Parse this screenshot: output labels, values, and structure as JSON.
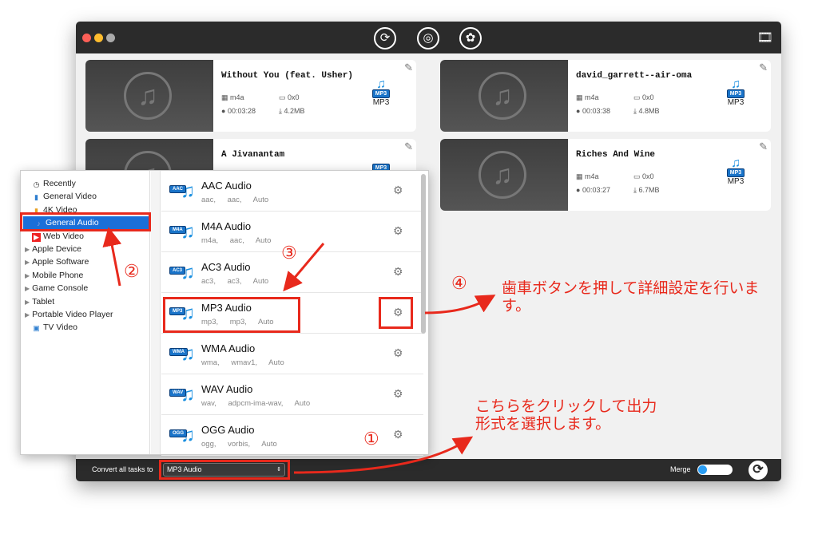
{
  "window": {
    "toolbar_icons": [
      "convert-icon",
      "burn-icon",
      "toolbox-icon"
    ],
    "media_icon": "media-browser-icon"
  },
  "tasks": [
    {
      "title": "Without You (feat. Usher)",
      "format": "m4a",
      "resolution": "0x0",
      "duration": "00:03:28",
      "size": "4.2MB",
      "target": "MP3"
    },
    {
      "title": "david_garrett--air-oma",
      "format": "m4a",
      "resolution": "0x0",
      "duration": "00:03:38",
      "size": "4.8MB",
      "target": "MP3"
    },
    {
      "title": "A Jivanantam",
      "format": "",
      "resolution": "",
      "duration": "",
      "size": "",
      "target": ""
    },
    {
      "title": "Riches And Wine",
      "format": "m4a",
      "resolution": "0x0",
      "duration": "00:03:27",
      "size": "6.7MB",
      "target": "MP3"
    }
  ],
  "sidebar": {
    "items": [
      {
        "label": "Recently",
        "icon": "clock-icon"
      },
      {
        "label": "General Video",
        "icon": "video-icon"
      },
      {
        "label": "4K Video",
        "icon": "4k-icon"
      },
      {
        "label": "General Audio",
        "icon": "audio-icon",
        "selected": true
      },
      {
        "label": "Web Video",
        "icon": "youtube-icon"
      },
      {
        "label": "Apple Device",
        "expandable": true
      },
      {
        "label": "Apple Software",
        "expandable": true
      },
      {
        "label": "Mobile Phone",
        "expandable": true
      },
      {
        "label": "Game Console",
        "expandable": true
      },
      {
        "label": "Tablet",
        "expandable": true
      },
      {
        "label": "Portable Video Player",
        "expandable": true
      },
      {
        "label": "TV Video",
        "icon": "tv-icon"
      }
    ]
  },
  "formats": [
    {
      "name": "AAC Audio",
      "badge": "AAC",
      "sub": "aac, aac, Auto"
    },
    {
      "name": "M4A Audio",
      "badge": "M4A",
      "sub": "m4a, aac, Auto"
    },
    {
      "name": "AC3 Audio",
      "badge": "AC3",
      "sub": "ac3, ac3, Auto"
    },
    {
      "name": "MP3 Audio",
      "badge": "MP3",
      "sub": "mp3, mp3, Auto"
    },
    {
      "name": "WMA Audio",
      "badge": "WMA",
      "sub": "wma, wmav1, Auto"
    },
    {
      "name": "WAV Audio",
      "badge": "WAV",
      "sub": "wav, adpcm-ima-wav, Auto"
    },
    {
      "name": "OGG Audio",
      "badge": "OGG",
      "sub": "ogg, vorbis, Auto"
    }
  ],
  "bottom": {
    "convert_label": "Convert all tasks to",
    "selected_format": "MP3 Audio",
    "merge_label": "Merge",
    "merge_on": false
  },
  "annotations": {
    "n1": "①",
    "n2": "②",
    "n3": "③",
    "n4": "④",
    "text4": "歯車ボタンを押して詳細設定を行います。",
    "text1": "こちらをクリックして出力形式を選択します。",
    "color": "#e8291c"
  }
}
